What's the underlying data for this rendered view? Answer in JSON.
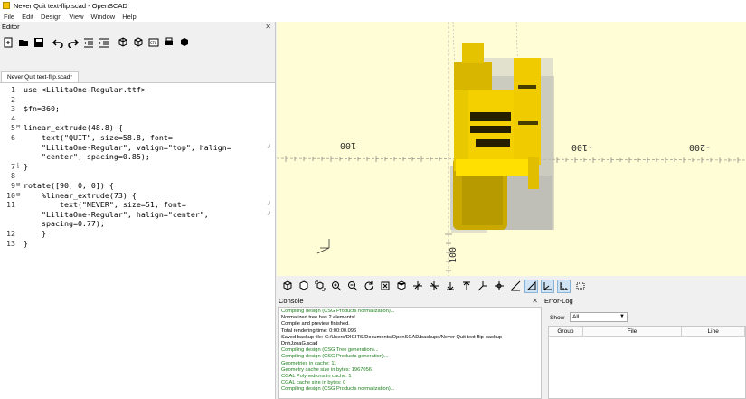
{
  "window": {
    "title": "Never Quit text-flip.scad - OpenSCAD"
  },
  "menu": [
    "File",
    "Edit",
    "Design",
    "View",
    "Window",
    "Help"
  ],
  "editor": {
    "title": "Editor",
    "tab_label": "Never Quit text-flip.scad*",
    "lines": [
      "use <LilitaOne-Regular.ttf>",
      "",
      "$fn=360;",
      "",
      "linear_extrude(48.8) {",
      "    text(\"QUIT\", size=58.8, font=",
      "    \"LilitaOne-Regular\", valign=\"top\", halign=",
      "    \"center\", spacing=0.85);",
      "}",
      "",
      "rotate([90, 0, 0]) {",
      "    %linear_extrude(73) {",
      "        text(\"NEVER\", size=51, font=",
      "    \"LilitaOne-Regular\", halign=\"center\",",
      "    spacing=0.77);",
      "    }",
      "}"
    ],
    "line_numbers": [
      "1",
      "",
      "2",
      "",
      "3",
      "",
      "4",
      "",
      "5",
      "6",
      "",
      "",
      "7",
      "",
      "8",
      "9",
      "10",
      "11",
      "",
      "",
      "12",
      "13"
    ]
  },
  "viewport": {
    "axis_labels": {
      "left_100": "100",
      "right_neg100": "-100",
      "right_neg200": "-200",
      "bottom_100": "100"
    },
    "colors": {
      "background": "#fffdd6",
      "quit_yellow": "#f5d000",
      "quit_shade": "#c9a800",
      "never_gray": "#b9b9b9"
    }
  },
  "console": {
    "title": "Console",
    "lines": [
      "Compiling design (CSG Products normalization)...",
      "Normalized tree has 2 elements!",
      "Compile and preview finished.",
      "Total rendering time: 0:00:00.096",
      "Saved backup file: C:/Users/DIGITS/Documents/OpenSCAD/backups/Never Quit text-flip-backup-",
      "DnhJzoaG.scad",
      "Compiling design (CSG Tree generation)...",
      "Compiling design (CSG Products generation)...",
      "Geometries in cache: 11",
      "Geometry cache size in bytes: 1967056",
      "CGAL Polyhedrons in cache: 1",
      "CGAL cache size in bytes: 0",
      "Compiling design (CSG Products normalization)..."
    ]
  },
  "errorlog": {
    "title": "Error-Log",
    "show_label": "Show",
    "show_value": "All",
    "columns": [
      "Group",
      "File",
      "Line"
    ]
  }
}
